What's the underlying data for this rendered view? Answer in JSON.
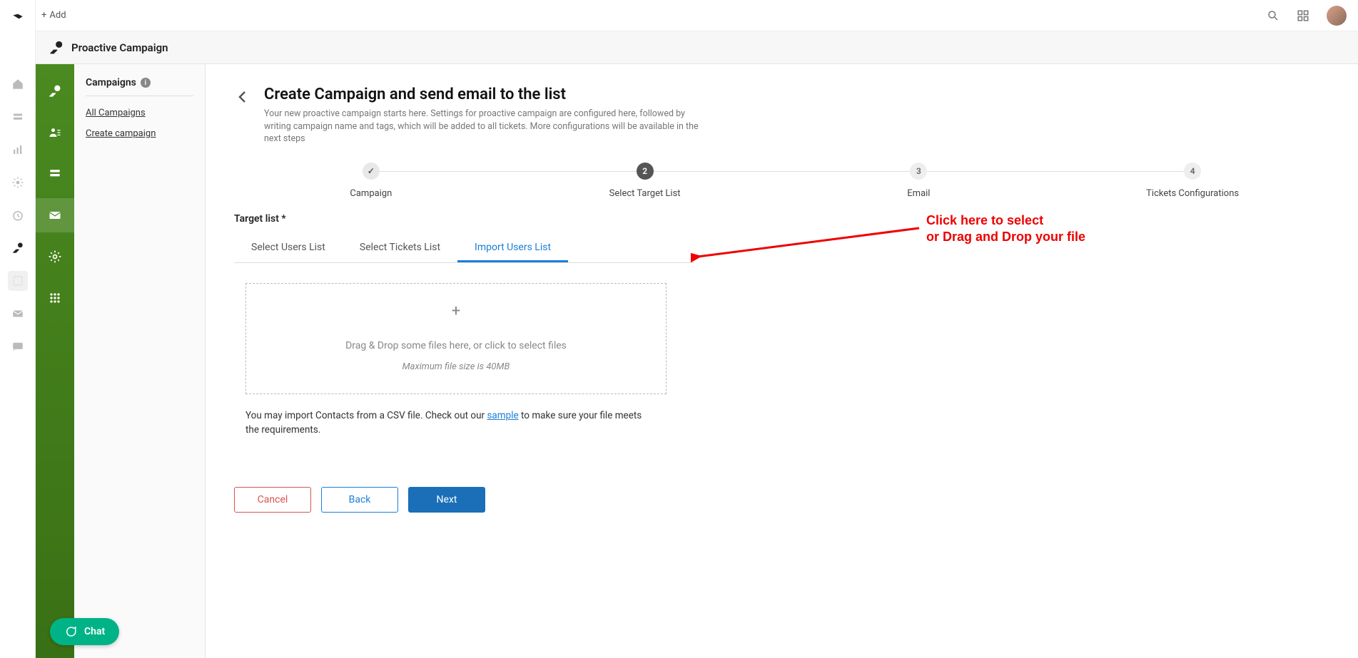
{
  "topbar": {
    "add_label": "Add"
  },
  "breadcrumb": {
    "title": "Proactive Campaign"
  },
  "navpanel": {
    "title": "Campaigns",
    "links": {
      "all": "All Campaigns",
      "create": "Create campaign"
    }
  },
  "page": {
    "title": "Create Campaign and send email to the list",
    "subtitle": "Your new proactive campaign starts here. Settings for proactive campaign are configured here, followed by writing campaign name and tags, which will be added to all tickets. More configurations will be available in the next steps"
  },
  "stepper": {
    "steps": [
      {
        "label": "Campaign",
        "badge": "✓",
        "state": "done"
      },
      {
        "label": "Select Target List",
        "badge": "2",
        "state": "active"
      },
      {
        "label": "Email",
        "badge": "3",
        "state": ""
      },
      {
        "label": "Tickets Configurations",
        "badge": "4",
        "state": ""
      }
    ]
  },
  "section": {
    "target_label": "Target list *"
  },
  "tabs": {
    "select_users": "Select Users List",
    "select_tickets": "Select Tickets List",
    "import_users": "Import Users List"
  },
  "dropzone": {
    "main": "Drag & Drop some files here, or click to select files",
    "sub": "Maximum file size is 40MB"
  },
  "import_note": {
    "prefix": "You may import Contacts from a CSV file. Check out our ",
    "link": "sample",
    "suffix": " to make sure your file meets the requirements."
  },
  "buttons": {
    "cancel": "Cancel",
    "back": "Back",
    "next": "Next"
  },
  "annotation": {
    "line1": "Click here to select",
    "line2": "or Drag and Drop your file"
  },
  "chat": {
    "label": "Chat"
  }
}
